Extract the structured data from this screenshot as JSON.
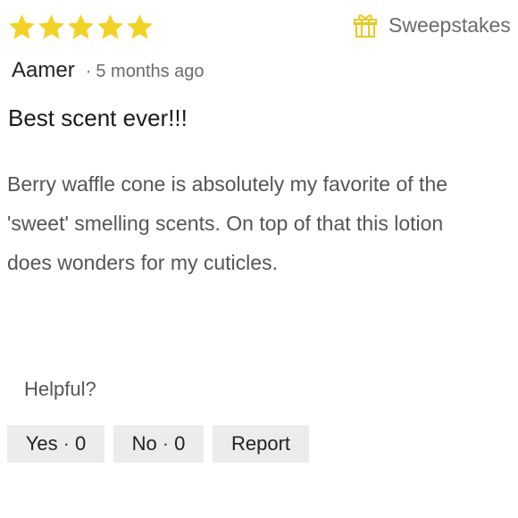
{
  "rating": {
    "value": 5,
    "max": 5,
    "star_color": "#f2d224"
  },
  "badge": {
    "icon": "gift-icon",
    "icon_color": "#f2d224",
    "label": "Sweepstakes"
  },
  "author": {
    "name": "Aamer",
    "separator": "·",
    "age": "5 months ago"
  },
  "review": {
    "title": "Best scent ever!!!",
    "body_lines": [
      "Berry waffle cone is absolutely my favorite of the",
      "'sweet' smelling scents. On top of that this lotion",
      "does wonders for my cuticles."
    ]
  },
  "feedback": {
    "prompt": "Helpful?",
    "yes_label": "Yes",
    "yes_count": "0",
    "no_label": "No",
    "no_count": "0",
    "dot": "·",
    "report_label": "Report"
  }
}
